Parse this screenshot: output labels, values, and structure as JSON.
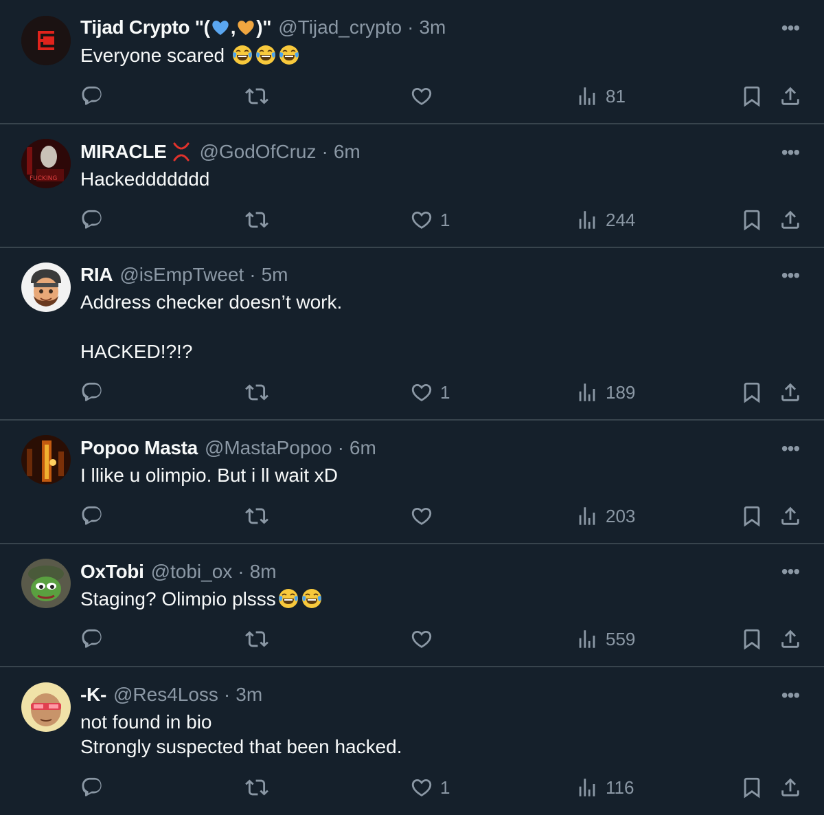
{
  "colors": {
    "background": "#15202b",
    "divider": "#38444d",
    "text": "#f7f9f9",
    "muted": "#8b98a5"
  },
  "tweets": [
    {
      "name": "Tijad Crypto \"(",
      "name_mid": ",",
      "name_end": ")\"",
      "handle": "@Tijad_crypto",
      "time": "3m",
      "text": "Everyone scared",
      "emoji_after": [
        "face-with-tears-of-joy",
        "face-with-tears-of-joy",
        "face-with-tears-of-joy"
      ],
      "likes": "",
      "views": "81"
    },
    {
      "name": "MIRACLE",
      "name_icon": "anger-symbol-icon",
      "handle": "@GodOfCruz",
      "time": "6m",
      "text": "Hackeddddddd",
      "likes": "1",
      "views": "244"
    },
    {
      "name": "RIA",
      "handle": "@isEmpTweet",
      "time": "5m",
      "text": "Address checker doesn’t work.\n\nHACKED!?!?",
      "likes": "1",
      "views": "189"
    },
    {
      "name": "Popoo Masta",
      "handle": "@MastaPopoo",
      "time": "6m",
      "text": "I llike u olimpio. But i ll wait xD",
      "likes": "",
      "views": "203"
    },
    {
      "name": "OxTobi",
      "handle": "@tobi_ox",
      "time": "8m",
      "text": "Staging? Olimpio plsss",
      "emoji_after": [
        "face-with-tears-of-joy",
        "face-with-tears-of-joy"
      ],
      "likes": "",
      "views": "559"
    },
    {
      "name": "-K-",
      "handle": "@Res4Loss",
      "time": "3m",
      "text": "not found in bio\nStrongly suspected that been hacked.",
      "likes": "1",
      "views": "116"
    }
  ],
  "ui": {
    "dot": "·",
    "more": "•••"
  }
}
